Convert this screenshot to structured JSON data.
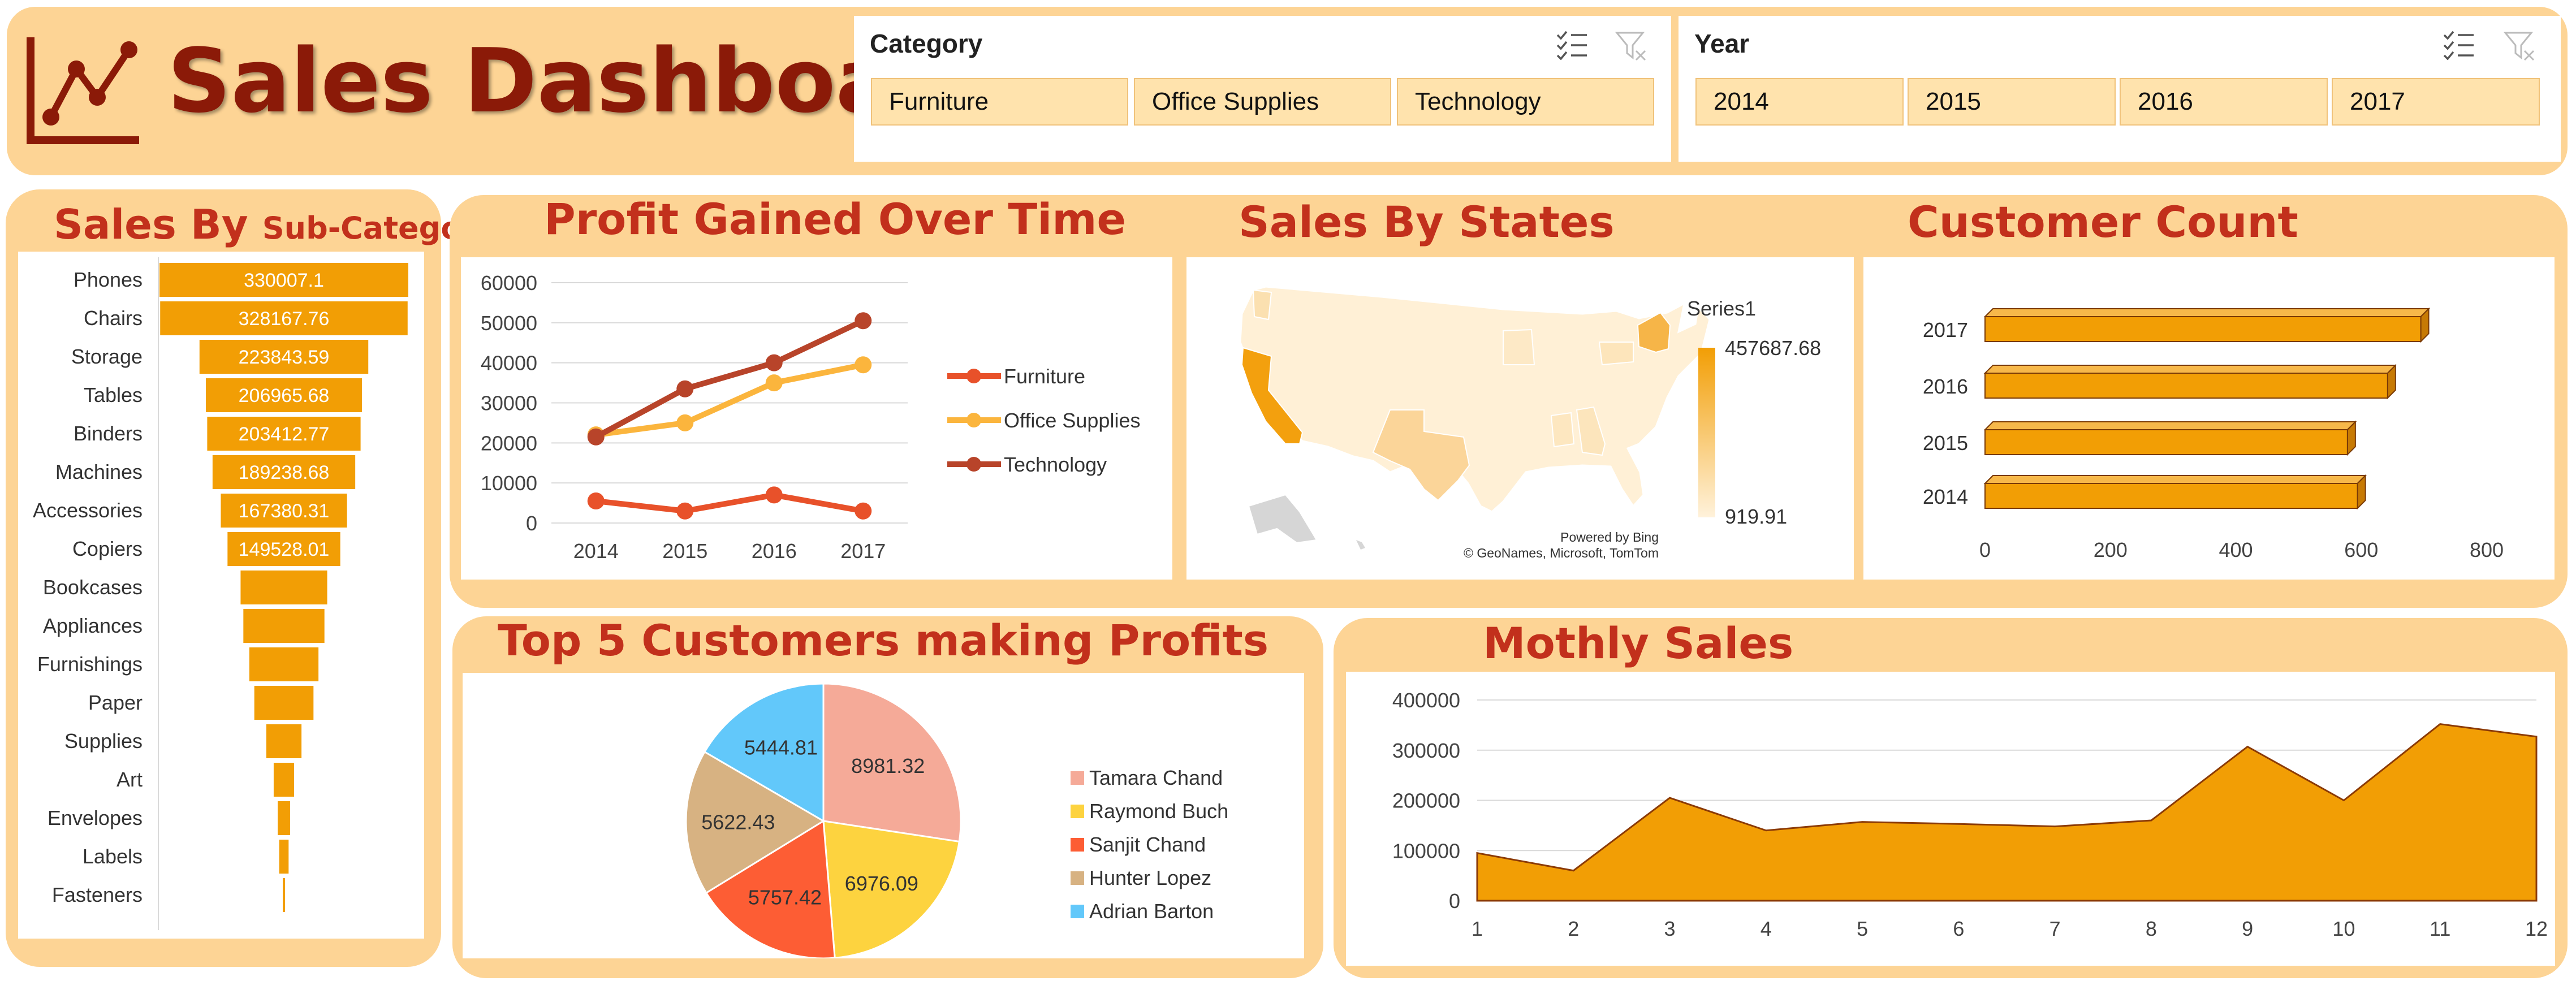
{
  "header": {
    "title": "Sales Dashboard",
    "logo_icon": "line-chart-icon",
    "accent_color": "#8b1a08"
  },
  "slicers": {
    "category": {
      "title": "Category",
      "items": [
        "Furniture",
        "Office Supplies",
        "Technology"
      ]
    },
    "year": {
      "title": "Year",
      "items": [
        "2014",
        "2015",
        "2016",
        "2017"
      ]
    },
    "multi_select_icon": "multi-select-icon",
    "clear_filter_icon": "clear-filter-icon"
  },
  "sales_by_subcategory": {
    "title_main": "Sales By ",
    "title_sub": "Sub-Category",
    "chart_data": {
      "type": "bar",
      "orientation": "funnel",
      "categories": [
        "Phones",
        "Chairs",
        "Storage",
        "Tables",
        "Binders",
        "Machines",
        "Accessories",
        "Copiers",
        "Bookcases",
        "Appliances",
        "Furnishings",
        "Paper",
        "Supplies",
        "Art",
        "Envelopes",
        "Labels",
        "Fasteners"
      ],
      "values": [
        330007.1,
        328167.76,
        223843.59,
        206965.68,
        203412.77,
        189238.68,
        167380.31,
        149528.01,
        114880.0,
        107532.0,
        91705.0,
        78479.0,
        46674.0,
        27119.0,
        16476.0,
        12486.0,
        3024.0
      ],
      "data_labels": [
        "330007.1",
        "328167.76",
        "223843.59",
        "206965.68",
        "203412.77",
        "189238.68",
        "167380.31",
        "149528.01",
        "",
        "",
        "",
        "",
        "",
        "",
        "",
        "",
        ""
      ],
      "color": "#f29e05"
    }
  },
  "profit_over_time": {
    "title": "Profit Gained Over Time",
    "chart_data": {
      "type": "line",
      "x": [
        "2014",
        "2015",
        "2016",
        "2017"
      ],
      "ylim": [
        0,
        60000
      ],
      "yticks": [
        "60000",
        "50000",
        "40000",
        "30000",
        "20000",
        "10000",
        "0"
      ],
      "series": [
        {
          "name": "Furniture",
          "values": [
            5500,
            3000,
            7000,
            3000
          ],
          "color": "#e8512a"
        },
        {
          "name": "Office Supplies",
          "values": [
            22000,
            25000,
            35000,
            39500
          ],
          "color": "#fbb53d"
        },
        {
          "name": "Technology",
          "values": [
            21500,
            33500,
            40000,
            50500
          ],
          "color": "#b8442a"
        }
      ]
    }
  },
  "sales_by_states": {
    "title": "Sales By States",
    "legend_title": "Series1",
    "max_label": "457687.68",
    "min_label": "919.91",
    "attribution_1": "Powered by Bing",
    "attribution_2": "© GeoNames, Microsoft, TomTom"
  },
  "customer_count": {
    "title": "Customer Count",
    "chart_data": {
      "type": "bar",
      "orientation": "horizontal",
      "categories": [
        "2017",
        "2016",
        "2015",
        "2014"
      ],
      "values": [
        695,
        642,
        578,
        594
      ],
      "xlim": [
        0,
        800
      ],
      "xticks": [
        "0",
        "200",
        "400",
        "600",
        "800"
      ],
      "color": "#f29e05"
    }
  },
  "top_customers": {
    "title": "Top 5 Customers making Profits",
    "chart_data": {
      "type": "pie",
      "labels": [
        "Tamara Chand",
        "Raymond Buch",
        "Sanjit Chand",
        "Hunter Lopez",
        "Adrian Barton"
      ],
      "values": [
        8981.32,
        6976.09,
        5757.42,
        5622.43,
        5444.81
      ],
      "value_labels": [
        "8981.32",
        "6976.09",
        "5757.42",
        "5622.43",
        "5444.81"
      ],
      "colors": [
        "#f5aa98",
        "#fdd33f",
        "#fd5d34",
        "#d7b282",
        "#62c8fa"
      ]
    }
  },
  "monthly_sales": {
    "title": "Mothly Sales",
    "chart_data": {
      "type": "area",
      "x": [
        "1",
        "2",
        "3",
        "4",
        "5",
        "6",
        "7",
        "8",
        "9",
        "10",
        "11",
        "12"
      ],
      "values": [
        95000,
        60000,
        205000,
        140000,
        157000,
        153000,
        148000,
        160000,
        307000,
        200000,
        352000,
        327000
      ],
      "ylim": [
        0,
        400000
      ],
      "yticks": [
        "400000",
        "300000",
        "200000",
        "100000",
        "0"
      ],
      "color": "#f29e05"
    }
  }
}
